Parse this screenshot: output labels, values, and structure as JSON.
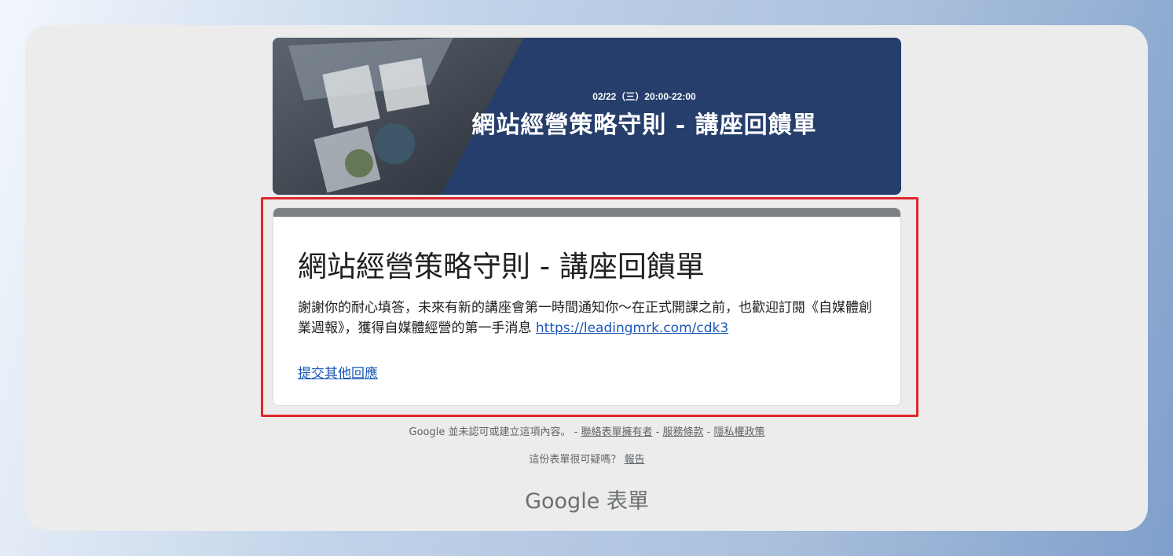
{
  "banner": {
    "date": "02/22（三）20:00-22:00",
    "title": "網站經營策略守則 - 講座回饋單"
  },
  "card": {
    "title": "網站經營策略守則 - 講座回饋單",
    "message": "謝謝你的耐心填答，未來有新的講座會第一時間通知你～在正式開課之前，也歡迎訂閱《自媒體創業週報》，獲得自媒體經營的第一手消息 ",
    "link_text": "https://leadingmrk.com/cdk3",
    "submit_another": "提交其他回應",
    "accent_color": "#7b8083"
  },
  "footer": {
    "disclaimer": "Google 並未認可或建立這項內容。 - ",
    "contact_owner": "聯絡表單擁有者",
    "sep1": " - ",
    "terms": "服務條款",
    "sep2": " - ",
    "privacy": "隱私權政策",
    "suspicious": "這份表單很可疑嗎？ ",
    "report": "報告",
    "brand": "Google 表單"
  }
}
